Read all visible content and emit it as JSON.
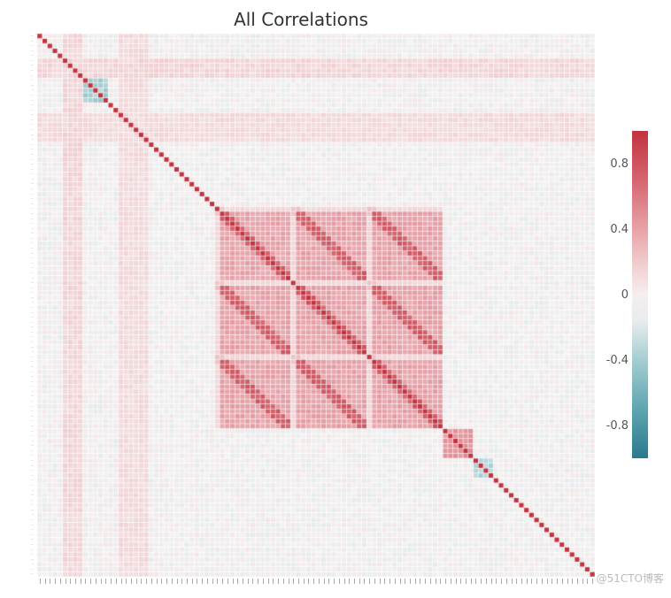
{
  "chart_data": {
    "type": "heatmap",
    "title": "All Correlations",
    "n_vars": 110,
    "value_range": [
      -1.0,
      1.0
    ],
    "colormap": {
      "name": "RdBu_r",
      "stops": [
        {
          "v": -1.0,
          "color": "#2a7a8c"
        },
        {
          "v": -0.6,
          "color": "#6fb0ba"
        },
        {
          "v": -0.2,
          "color": "#c8dde0"
        },
        {
          "v": 0.0,
          "color": "#f3f1f1"
        },
        {
          "v": 0.2,
          "color": "#f1d0d3"
        },
        {
          "v": 0.6,
          "color": "#dd858e"
        },
        {
          "v": 1.0,
          "color": "#c1333f"
        }
      ]
    },
    "colorbar_ticks": [
      0.8,
      0.4,
      0.0,
      -0.4,
      -0.8
    ],
    "diagonal_value": 1.0,
    "structure_note": "Large positively-correlated block roughly between variable indices 35 and 80 (values ~0.3–0.7 off-diagonal); remainder near zero with scattered mild negatives around rows ~10–14 and cols ~85–90.",
    "off_diagonal_typical": 0.05,
    "central_block": {
      "start": 35,
      "end": 80,
      "typical_value": 0.45
    },
    "secondary_block": {
      "start": 80,
      "end": 86,
      "typical_value": 0.55
    },
    "negative_spots": [
      {
        "row_band": [
          9,
          14
        ],
        "col_band": [
          9,
          14
        ],
        "value": -0.35
      },
      {
        "row_band": [
          86,
          90
        ],
        "col_band": [
          86,
          90
        ],
        "value": -0.3
      }
    ],
    "xlabel": "",
    "ylabel": ""
  },
  "watermark": "@51CTO博客"
}
